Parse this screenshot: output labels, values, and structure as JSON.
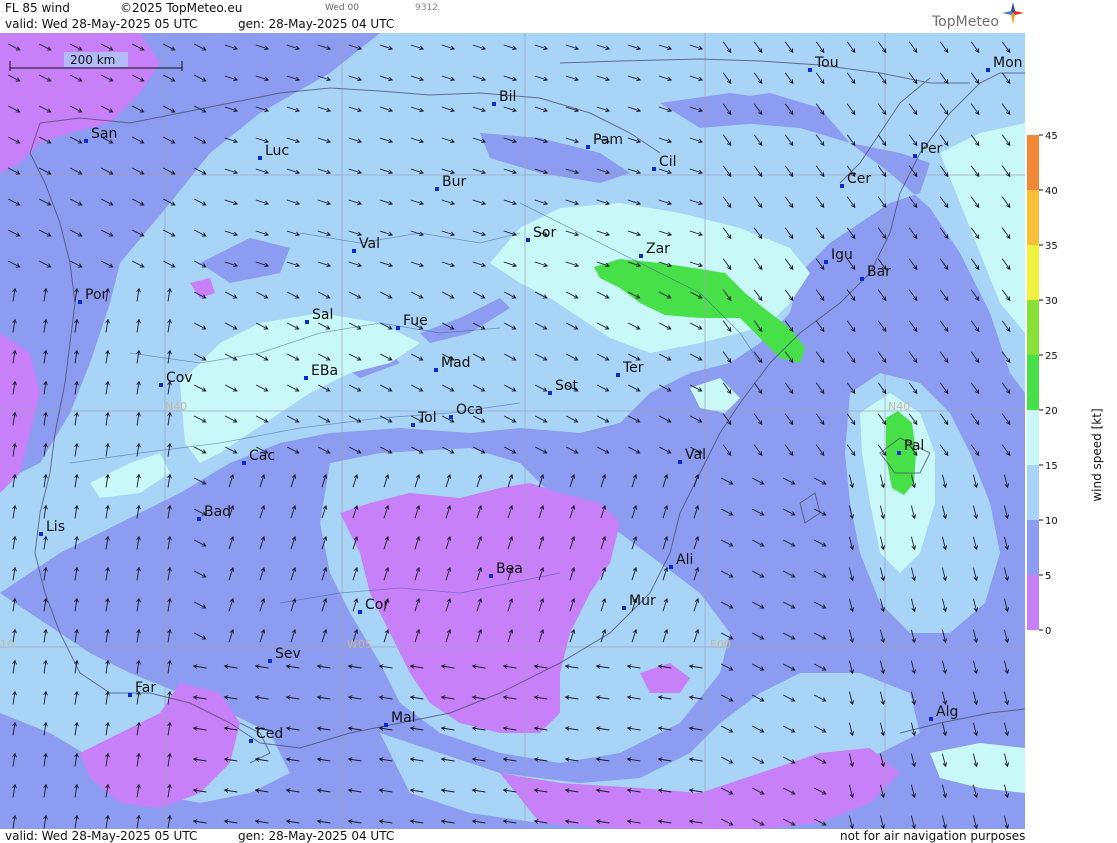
{
  "header": {
    "product": "FL 85 wind",
    "copyright": "©2025 TopMeteo.eu",
    "run": "Wed 00",
    "code": "9312",
    "valid": "valid:  Wed  28-May-2025  05 UTC",
    "gen": "gen: 28-May-2025 04 UTC",
    "logo": "TopMeteo"
  },
  "footer": {
    "valid": "valid:  Wed  28-May-2025  05 UTC",
    "gen": "gen: 28-May-2025 04 UTC",
    "disclaimer": "not for air navigation purposes"
  },
  "scale_bar": {
    "label": "200 km"
  },
  "grid_labels": {
    "lat1": "N40",
    "lat2": "N40",
    "lon1": "W05",
    "lon2": "E00",
    "lon3": "10"
  },
  "legend": {
    "title": "wind speed [kt]",
    "ticks": [
      "45",
      "40",
      "35",
      "30",
      "25",
      "20",
      "15",
      "10",
      "5",
      "0"
    ],
    "colors": [
      "#e05050",
      "#f08838",
      "#f8c038",
      "#f0f040",
      "#88e038",
      "#48e048",
      "#c8f8f8",
      "#a8d4f8",
      "#8c9cf0",
      "#c880f8"
    ]
  },
  "colors": {
    "land_purple": "#c880f8",
    "slate": "#8c9cf0",
    "light_blue": "#a8d4f8",
    "cyan": "#c8f8f8",
    "green": "#48e048"
  },
  "cities": [
    {
      "id": "san",
      "label": "San"
    },
    {
      "id": "luc",
      "label": "Luc"
    },
    {
      "id": "bil",
      "label": "Bil"
    },
    {
      "id": "pam",
      "label": "Pam"
    },
    {
      "id": "cil",
      "label": "Cil"
    },
    {
      "id": "tou",
      "label": "Tou"
    },
    {
      "id": "mon",
      "label": "Mon"
    },
    {
      "id": "per",
      "label": "Per"
    },
    {
      "id": "cer",
      "label": "Cer"
    },
    {
      "id": "bur",
      "label": "Bur"
    },
    {
      "id": "sor",
      "label": "Sor"
    },
    {
      "id": "zar",
      "label": "Zar"
    },
    {
      "id": "val1",
      "label": "Val"
    },
    {
      "id": "igu",
      "label": "Igu"
    },
    {
      "id": "bar",
      "label": "Bar"
    },
    {
      "id": "por",
      "label": "Por"
    },
    {
      "id": "sal",
      "label": "Sal"
    },
    {
      "id": "fue",
      "label": "Fue"
    },
    {
      "id": "mad",
      "label": "Mad"
    },
    {
      "id": "ter",
      "label": "Ter"
    },
    {
      "id": "cov",
      "label": "Cov"
    },
    {
      "id": "eba",
      "label": "EBa"
    },
    {
      "id": "sot",
      "label": "Sot"
    },
    {
      "id": "tol",
      "label": "Tol"
    },
    {
      "id": "oca",
      "label": "Oca"
    },
    {
      "id": "cac",
      "label": "Cac"
    },
    {
      "id": "val2",
      "label": "Val"
    },
    {
      "id": "pal",
      "label": "Pal"
    },
    {
      "id": "bad",
      "label": "Bad"
    },
    {
      "id": "lis",
      "label": "Lis"
    },
    {
      "id": "ali",
      "label": "Ali"
    },
    {
      "id": "bea",
      "label": "Bea"
    },
    {
      "id": "mur",
      "label": "Mur"
    },
    {
      "id": "cor",
      "label": "Cor"
    },
    {
      "id": "sev",
      "label": "Sev"
    },
    {
      "id": "far",
      "label": "Far"
    },
    {
      "id": "mal",
      "label": "Mal"
    },
    {
      "id": "alg",
      "label": "Alg"
    },
    {
      "id": "ced",
      "label": "Ced"
    }
  ]
}
